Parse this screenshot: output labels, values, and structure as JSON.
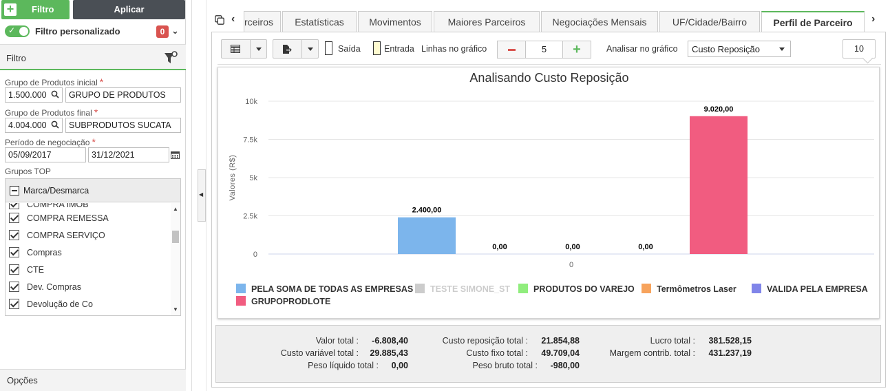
{
  "toolbar": {
    "filtro_label": "Filtro",
    "aplicar_label": "Aplicar"
  },
  "custom_filter": {
    "label": "Filtro personalizado",
    "count": "0"
  },
  "filter_panel": {
    "title": "Filtro",
    "grupo_inicial": {
      "label": "Grupo de Produtos inicial",
      "code": "1.500.000",
      "name": "GRUPO DE PRODUTOS"
    },
    "grupo_final": {
      "label": "Grupo de Produtos final",
      "code": "4.004.000",
      "name": "SUBPRODUTOS SUCATA"
    },
    "periodo": {
      "label": "Período de negociação",
      "start": "05/09/2017",
      "end": "31/12/2021"
    },
    "grupos_top": {
      "label": "Grupos TOP",
      "toggle_label": "Marca/Desmarca",
      "items": [
        {
          "label": "COMPRA IMOB"
        },
        {
          "label": "COMPRA REMESSA"
        },
        {
          "label": "COMPRA SERVIÇO"
        },
        {
          "label": "Compras"
        },
        {
          "label": "CTE"
        },
        {
          "label": "Dev. Compras"
        },
        {
          "label": "Devolução de Co"
        }
      ]
    }
  },
  "opcoes_label": "Opções",
  "tabs": [
    {
      "label": "Parceiros"
    },
    {
      "label": "Estatísticas"
    },
    {
      "label": "Movimentos"
    },
    {
      "label": "Maiores Parceiros"
    },
    {
      "label": "Negociações Mensais"
    },
    {
      "label": "UF/Cidade/Bairro"
    },
    {
      "label": "Perfil de Parceiro"
    }
  ],
  "chart_toolbar": {
    "saida_label": "Saída",
    "entrada_label": "Entrada",
    "linhas_label": "Linhas no gráfico",
    "linhas_value": "5",
    "analisar_label": "Analisar no gráfico",
    "analisar_value": "Custo Reposição",
    "callout_value": "10"
  },
  "chart_data": {
    "type": "bar",
    "title": "Analisando Custo Reposição",
    "ylabel": "Valores (R$)",
    "xlabel": "",
    "categories": [
      "0"
    ],
    "ylim": [
      0,
      10000
    ],
    "yticks": [
      "0",
      "2.5k",
      "5k",
      "7.5k",
      "10k"
    ],
    "ytick_values": [
      0,
      2500,
      5000,
      7500,
      10000
    ],
    "grid": true,
    "legend_position": "bottom",
    "series": [
      {
        "name": "PELA SOMA DE TODAS AS EMPRESAS",
        "values": [
          2400
        ],
        "label": "2.400,00",
        "color": "#7cb5ec",
        "visible": true
      },
      {
        "name": "TESTE SIMONE_ST",
        "values": [
          0
        ],
        "label": "",
        "color": "#cccccc",
        "visible": false
      },
      {
        "name": "PRODUTOS DO VAREJO",
        "values": [
          0
        ],
        "label": "0,00",
        "color": "#90ed7d",
        "visible": true
      },
      {
        "name": "Termômetros Laser",
        "values": [
          0
        ],
        "label": "0,00",
        "color": "#f7a35c",
        "visible": true
      },
      {
        "name": "VALIDA PELA EMPRESA",
        "values": [
          0
        ],
        "label": "0,00",
        "color": "#8085e9",
        "visible": true
      },
      {
        "name": "GRUPOPRODLOTE",
        "values": [
          9020
        ],
        "label": "9.020,00",
        "color": "#f15c80",
        "visible": true
      }
    ]
  },
  "totals": {
    "valor_total": {
      "label": "Valor total :",
      "value": "-6.808,40"
    },
    "custo_variavel": {
      "label": "Custo variável total :",
      "value": "29.885,43"
    },
    "peso_liquido": {
      "label": "Peso líquido total :",
      "value": "0,00"
    },
    "custo_reposicao": {
      "label": "Custo reposição total :",
      "value": "21.854,88"
    },
    "custo_fixo": {
      "label": "Custo fixo total :",
      "value": "49.709,04"
    },
    "peso_bruto": {
      "label": "Peso bruto total :",
      "value": "-980,00"
    },
    "lucro_total": {
      "label": "Lucro total :",
      "value": "381.528,15"
    },
    "margem_contrib": {
      "label": "Margem contrib. total :",
      "value": "431.237,19"
    }
  }
}
